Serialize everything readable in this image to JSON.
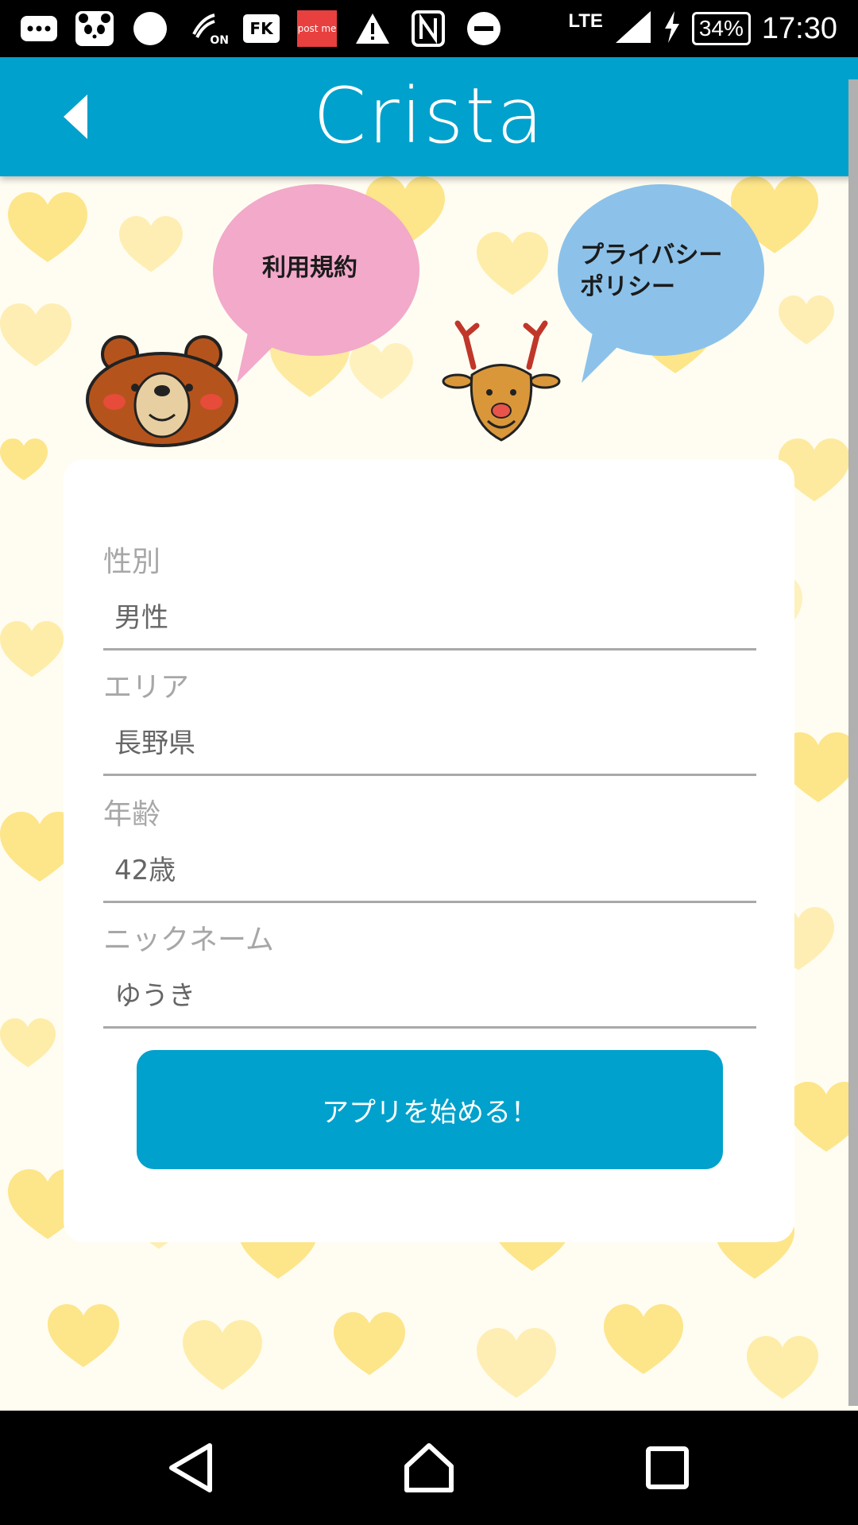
{
  "status_bar": {
    "time": "17:30",
    "battery": "34%",
    "network": "LTE",
    "notification_icons": [
      "message-icon",
      "panda-icon",
      "circle-icon",
      "nfc-on-icon",
      "fk-app-icon",
      "postme-app-icon",
      "warning-icon",
      "n-icon",
      "do-not-disturb-icon"
    ],
    "postme_label": "post me",
    "nfc_on_label": "ON",
    "fk_label": "FK"
  },
  "app_bar": {
    "title": "Crista",
    "back_icon": "back-arrow-icon"
  },
  "links": {
    "terms_label": "利用規約",
    "privacy_label_line1": "プライバシー",
    "privacy_label_line2": "ポリシー"
  },
  "form": {
    "fields": [
      {
        "label": "性別",
        "value": "男性"
      },
      {
        "label": "エリア",
        "value": "長野県"
      },
      {
        "label": "年齢",
        "value": "42歳"
      },
      {
        "label": "ニックネーム",
        "value": "ゆうき"
      }
    ],
    "submit_label": "アプリを始める！"
  },
  "colors": {
    "accent": "#00a1cc",
    "pink_bubble": "#f2a9ca",
    "blue_bubble": "#8cc2ea",
    "heart": "#fde58a"
  },
  "nav_bar": {
    "icons": [
      "nav-back-icon",
      "nav-home-icon",
      "nav-recents-icon"
    ]
  }
}
